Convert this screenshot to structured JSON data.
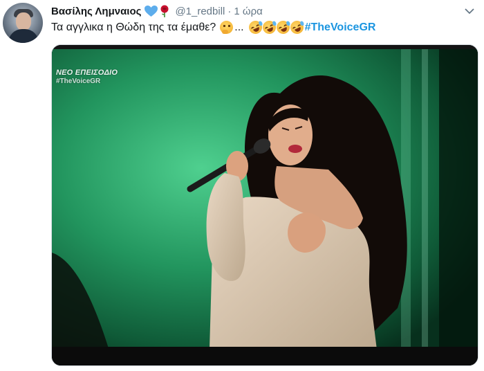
{
  "tweet": {
    "author_name": "Βασίλης Λημναιος",
    "handle": "@1_redbill",
    "separator": "·",
    "time": "1 ώρα",
    "text": "Τα αγγλικα  η Θώδη της τα έμαθε?",
    "ellipsis": "...",
    "hashtag": "#TheVoiceGR",
    "author_emojis": [
      "blue-heart-icon",
      "rose-icon"
    ],
    "text_emojis": [
      "thinking-face-icon",
      "rofl-icon",
      "rofl-icon",
      "rofl-icon",
      "rofl-icon"
    ]
  },
  "media": {
    "overlay_line1": "ΝΕΟ ΕΠΕΙΣΟΔΙΟ",
    "overlay_line2": "#TheVoiceGR"
  },
  "colors": {
    "link": "#1b95e0",
    "secondary_text": "#657786",
    "stage_green": "#2fa06a"
  }
}
